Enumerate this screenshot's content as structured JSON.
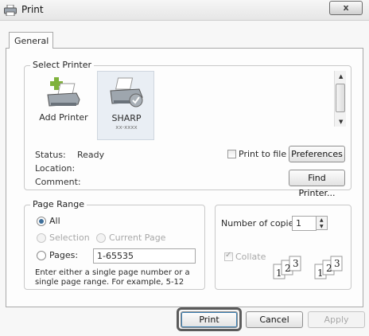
{
  "window": {
    "title": "Print",
    "close_label": "x"
  },
  "tabs": [
    {
      "label": "General"
    }
  ],
  "select_printer": {
    "legend": "Select Printer",
    "printers": [
      {
        "name": "Add Printer",
        "subtitle": ""
      },
      {
        "name": "SHARP",
        "subtitle": "xx-xxxx",
        "selected": true
      }
    ],
    "status_label": "Status:",
    "status_value": "Ready",
    "location_label": "Location:",
    "location_value": "",
    "comment_label": "Comment:",
    "comment_value": "",
    "print_to_file_label": "Print to file",
    "print_to_file_checked": false,
    "preferences_label": "Preferences",
    "find_printer_label": "Find Printer..."
  },
  "page_range": {
    "legend": "Page Range",
    "options": [
      {
        "label": "All",
        "selected": true,
        "enabled": true
      },
      {
        "label": "Selection",
        "selected": false,
        "enabled": false
      },
      {
        "label": "Current Page",
        "selected": false,
        "enabled": false
      },
      {
        "label": "Pages:",
        "selected": false,
        "enabled": true
      }
    ],
    "pages_value": "1-65535",
    "hint": "Enter either a single page number or a single page range.  For example, 5-12"
  },
  "copies": {
    "label": "Number of copies:",
    "value": "1",
    "collate_label": "Collate",
    "collate_checked": true,
    "collate_enabled": false,
    "collate_page_numbers": [
      "1",
      "2",
      "3",
      "1",
      "2",
      "3"
    ]
  },
  "buttons": {
    "print": "Print",
    "cancel": "Cancel",
    "apply": "Apply"
  },
  "colors": {
    "selected_printer_bg": "#e9eef4",
    "radio_dot": "#3f6f9a",
    "disabled_text": "#a8a8a8"
  },
  "icons": {
    "title": "printer-icon",
    "add_printer": "add-printer-icon",
    "sharp": "printer-default-icon",
    "collate": "collate-pages-icon"
  }
}
